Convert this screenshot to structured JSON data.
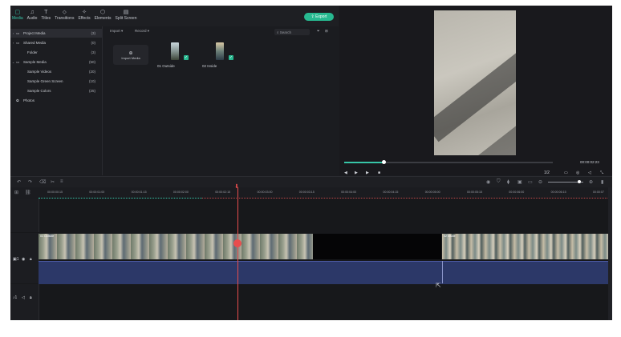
{
  "tabs": [
    {
      "label": "Media",
      "icon": "media-icon",
      "glyph": "▢"
    },
    {
      "label": "Audio",
      "icon": "music-note-icon",
      "glyph": "♫"
    },
    {
      "label": "Titles",
      "icon": "text-icon",
      "glyph": "T"
    },
    {
      "label": "Transitions",
      "icon": "transitions-icon",
      "glyph": "⬦"
    },
    {
      "label": "Effects",
      "icon": "effects-icon",
      "glyph": "✧"
    },
    {
      "label": "Elements",
      "icon": "elements-icon",
      "glyph": "⬡"
    },
    {
      "label": "Split Screen",
      "icon": "split-screen-icon",
      "glyph": "▤"
    }
  ],
  "export_label": "Export",
  "sidebar": [
    {
      "label": "Project Media",
      "count": "(3)",
      "arrow": "›",
      "selected": true
    },
    {
      "label": "Shared Media",
      "count": "(0)",
      "arrow": "›",
      "selected": false
    },
    {
      "label": "Folder",
      "count": "(3)",
      "arrow": "",
      "selected": false
    },
    {
      "label": "Sample Media",
      "count": "(50)",
      "arrow": "⌄",
      "selected": false
    },
    {
      "label": "Sample Videos",
      "count": "(20)",
      "arrow": "",
      "selected": false
    },
    {
      "label": "Sample Green Screen",
      "count": "(10)",
      "arrow": "",
      "selected": false
    },
    {
      "label": "Sample Colors",
      "count": "(25)",
      "arrow": "",
      "selected": false
    },
    {
      "label": "Photos",
      "count": "",
      "arrow": "",
      "selected": false
    }
  ],
  "content": {
    "import_label": "Import ▾",
    "record_label": "Record ▾",
    "search_placeholder": "Search",
    "import_media_label": "Import Media",
    "items": [
      {
        "label": "01 Outside"
      },
      {
        "label": "02 Inside"
      }
    ]
  },
  "preview": {
    "timecode": "00:00:02:23",
    "zoom": "1/2"
  },
  "ruler": [
    "00:00:00:15",
    "00:00:01:00",
    "00:00:01:15",
    "00:00:02:00",
    "00:00:02:15",
    "00:00:03:00",
    "00:00:03:15",
    "00:00:04:00",
    "00:00:04:15",
    "00:00:05:00",
    "00:00:05:15",
    "00:00:06:00",
    "00:00:06:15",
    "00:00:07"
  ],
  "clips": {
    "clip1": "01 Outside",
    "clip2": "02 Inside"
  },
  "colors": {
    "accent": "#27b990",
    "playhead": "#e84d4d",
    "audio_track": "#2c3868"
  }
}
